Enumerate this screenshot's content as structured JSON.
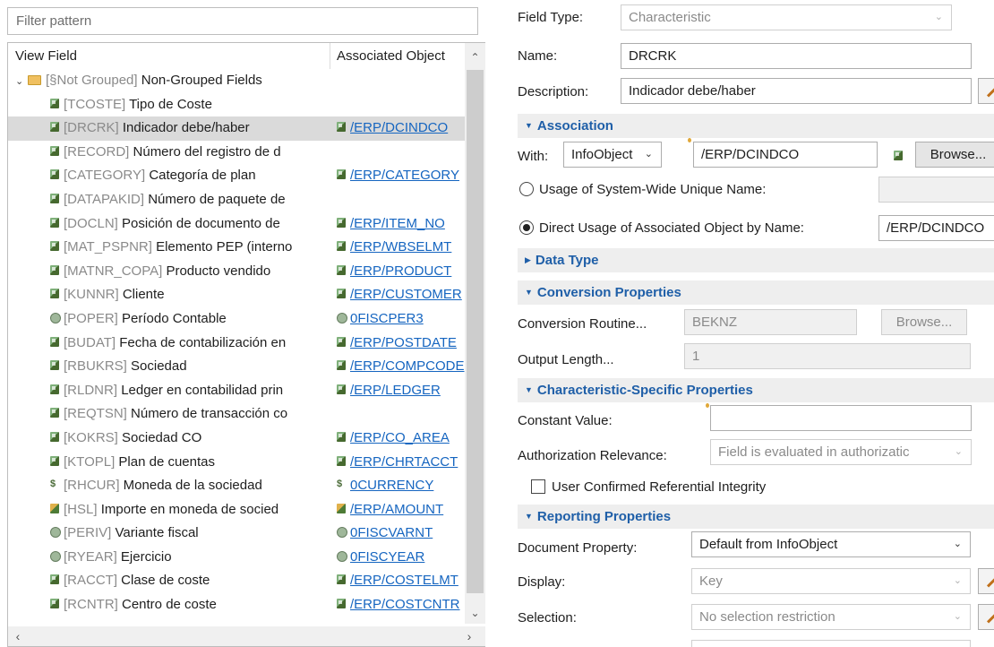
{
  "filter": {
    "placeholder": "Filter pattern"
  },
  "tree": {
    "headers": {
      "view_field": "View Field",
      "associated_object": "Associated Object"
    },
    "group_label": {
      "prefix": "[§Not Grouped]",
      "name": "Non-Grouped Fields"
    },
    "rows": [
      {
        "tech": "[TCOSTE]",
        "desc": "Tipo de Coste",
        "icon": "characteristic-icon",
        "obj": ""
      },
      {
        "tech": "[DRCRK]",
        "desc": "Indicador debe/haber",
        "icon": "characteristic-icon",
        "obj": "/ERP/DCINDCO",
        "selected": true
      },
      {
        "tech": "[RECORD]",
        "desc": "Número del registro de d",
        "icon": "characteristic-icon",
        "obj": ""
      },
      {
        "tech": "[CATEGORY]",
        "desc": "Categoría de plan",
        "icon": "characteristic-icon",
        "obj": "/ERP/CATEGORY"
      },
      {
        "tech": "[DATAPAKID]",
        "desc": "Número de paquete de",
        "icon": "characteristic-icon",
        "obj": ""
      },
      {
        "tech": "[DOCLN]",
        "desc": "Posición de documento de",
        "icon": "characteristic-icon",
        "obj": "/ERP/ITEM_NO"
      },
      {
        "tech": "[MAT_PSPNR]",
        "desc": "Elemento PEP (interno",
        "icon": "characteristic-icon",
        "obj": "/ERP/WBSELMT"
      },
      {
        "tech": "[MATNR_COPA]",
        "desc": "Producto vendido",
        "icon": "characteristic-icon",
        "obj": "/ERP/PRODUCT"
      },
      {
        "tech": "[KUNNR]",
        "desc": "Cliente",
        "icon": "characteristic-icon",
        "obj": "/ERP/CUSTOMER"
      },
      {
        "tech": "[POPER]",
        "desc": "Período Contable",
        "icon": "time-characteristic-icon",
        "obj": "0FISCPER3"
      },
      {
        "tech": "[BUDAT]",
        "desc": "Fecha de contabilización en",
        "icon": "characteristic-icon",
        "obj": "/ERP/POSTDATE"
      },
      {
        "tech": "[RBUKRS]",
        "desc": "Sociedad",
        "icon": "characteristic-icon",
        "obj": "/ERP/COMPCODE"
      },
      {
        "tech": "[RLDNR]",
        "desc": "Ledger en contabilidad prin",
        "icon": "characteristic-icon",
        "obj": "/ERP/LEDGER"
      },
      {
        "tech": "[REQTSN]",
        "desc": "Número de transacción co",
        "icon": "characteristic-icon",
        "obj": ""
      },
      {
        "tech": "[KOKRS]",
        "desc": "Sociedad CO",
        "icon": "characteristic-icon",
        "obj": "/ERP/CO_AREA"
      },
      {
        "tech": "[KTOPL]",
        "desc": "Plan de cuentas",
        "icon": "characteristic-icon",
        "obj": "/ERP/CHRTACCT"
      },
      {
        "tech": "[RHCUR]",
        "desc": "Moneda de la sociedad",
        "icon": "unit-icon",
        "obj": "0CURRENCY"
      },
      {
        "tech": "[HSL]",
        "desc": "Importe en moneda de socied",
        "icon": "key-figure-icon",
        "obj": "/ERP/AMOUNT"
      },
      {
        "tech": "[PERIV]",
        "desc": "Variante fiscal",
        "icon": "time-characteristic-icon",
        "obj": "0FISCVARNT"
      },
      {
        "tech": "[RYEAR]",
        "desc": "Ejercicio",
        "icon": "time-characteristic-icon",
        "obj": "0FISCYEAR"
      },
      {
        "tech": "[RACCT]",
        "desc": "Clase de coste",
        "icon": "characteristic-icon",
        "obj": "/ERP/COSTELMT"
      },
      {
        "tech": "[RCNTR]",
        "desc": "Centro de coste",
        "icon": "characteristic-icon",
        "obj": "/ERP/COSTCNTR"
      }
    ]
  },
  "details": {
    "field_type": {
      "label": "Field Type:",
      "value": "Characteristic"
    },
    "name": {
      "label": "Name:",
      "value": "DRCRK"
    },
    "description": {
      "label": "Description:",
      "value": "Indicador debe/haber"
    },
    "association": {
      "title": "Association",
      "with_label": "With:",
      "with_value": "InfoObject",
      "object_value": "/ERP/DCINDCO",
      "browse": "Browse...",
      "usage_unique": "Usage of System-Wide Unique Name:",
      "usage_direct": "Direct Usage of Associated Object by Name:",
      "direct_value": "/ERP/DCINDCO"
    },
    "data_type": {
      "title": "Data Type"
    },
    "conversion": {
      "title": "Conversion Properties",
      "routine_label": "Conversion Routine...",
      "routine_value": "BEKNZ",
      "browse": "Browse...",
      "output_label": "Output Length...",
      "output_value": "1"
    },
    "char_specific": {
      "title": "Characteristic-Specific Properties",
      "constant_label": "Constant Value:",
      "constant_value": "",
      "auth_label": "Authorization Relevance:",
      "auth_value": "Field is evaluated in authorizatic",
      "ref_integrity": "User Confirmed Referential Integrity"
    },
    "reporting": {
      "title": "Reporting Properties",
      "doc_label": "Document Property:",
      "doc_value": "Default from InfoObject",
      "display_label": "Display:",
      "display_value": "Key",
      "selection_label": "Selection:",
      "selection_value": "No selection restriction"
    }
  }
}
